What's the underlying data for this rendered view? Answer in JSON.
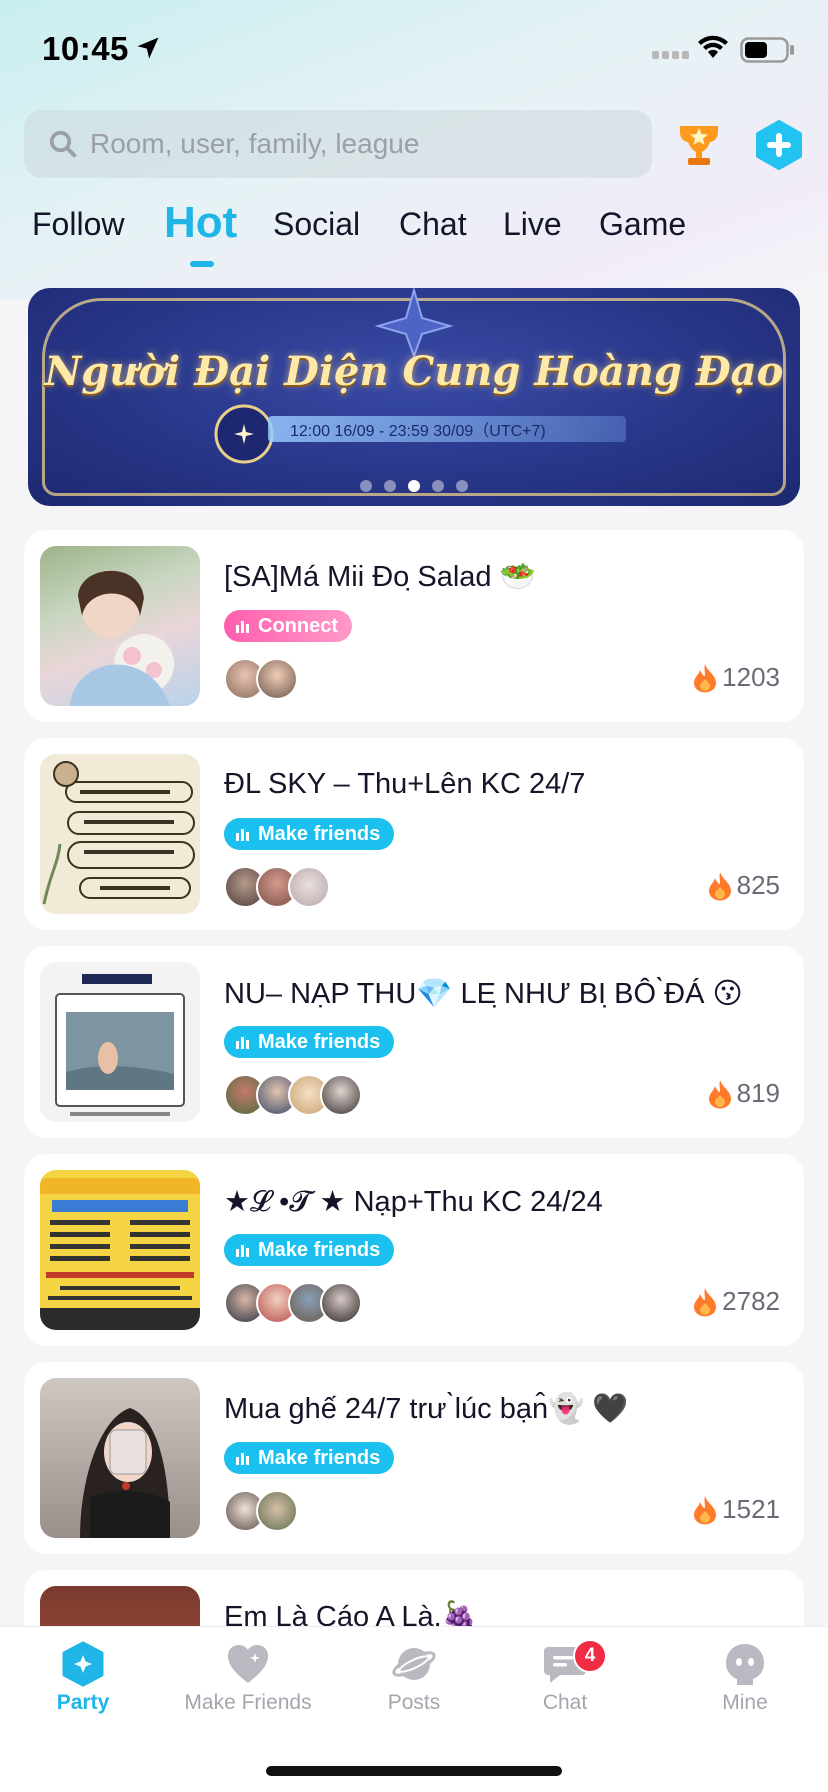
{
  "status_bar": {
    "time": "10:45"
  },
  "search": {
    "placeholder": "Room, user, family, league"
  },
  "tabs": [
    {
      "label": "Follow",
      "active": false
    },
    {
      "label": "Hot",
      "active": true
    },
    {
      "label": "Social",
      "active": false
    },
    {
      "label": "Chat",
      "active": false
    },
    {
      "label": "Live",
      "active": false
    },
    {
      "label": "Game",
      "active": false
    }
  ],
  "banner": {
    "title": "Người Đại Diện Cung Hoàng Đạo",
    "date": "12:00 16/09 - 23:59 30/09（UTC+7)",
    "dot_count": 5,
    "active_dot": 2
  },
  "rooms": [
    {
      "title": "[SA]Má Mii Đo ̣Salad 🥗",
      "tag": "Connect",
      "tag_type": "connect",
      "heat": "1203",
      "avatar_count": 2
    },
    {
      "title": "ĐL SKY – Thu+Lên KC 24/7",
      "tag": "Make friends",
      "tag_type": "friends",
      "heat": "825",
      "avatar_count": 3
    },
    {
      "title": "NU– NẠP THU💎 LE ̣NHƯ BI ̣BÔ ̀ĐÁ 😗",
      "tag": "Make friends",
      "tag_type": "friends",
      "heat": "819",
      "avatar_count": 4
    },
    {
      "title": "★𝓛 •𝓣 ★ Nạp+Thu KC 24/24",
      "tag": "Make friends",
      "tag_type": "friends",
      "heat": "2782",
      "avatar_count": 4
    },
    {
      "title": "Mua ghế 24/7 trư ̀lúc bạn̂👻 🖤",
      "tag": "Make friends",
      "tag_type": "friends",
      "heat": "1521",
      "avatar_count": 2
    },
    {
      "title": "Em Là Cáo A Là.🍇",
      "tag": "",
      "tag_type": "",
      "heat": "",
      "avatar_count": 0
    }
  ],
  "bottom_nav": [
    {
      "label": "Party",
      "icon": "party-icon",
      "active": true
    },
    {
      "label": "Make Friends",
      "icon": "heart-icon",
      "active": false
    },
    {
      "label": "Posts",
      "icon": "planet-icon",
      "active": false
    },
    {
      "label": "Chat",
      "icon": "chat-icon",
      "active": false,
      "badge": "4"
    },
    {
      "label": "Mine",
      "icon": "ghost-icon",
      "active": false
    }
  ],
  "colors": {
    "accent": "#1fb5e6",
    "connect_tag": "#ff5fae",
    "friends_tag": "#1cc0ee",
    "badge": "#f22c45"
  }
}
